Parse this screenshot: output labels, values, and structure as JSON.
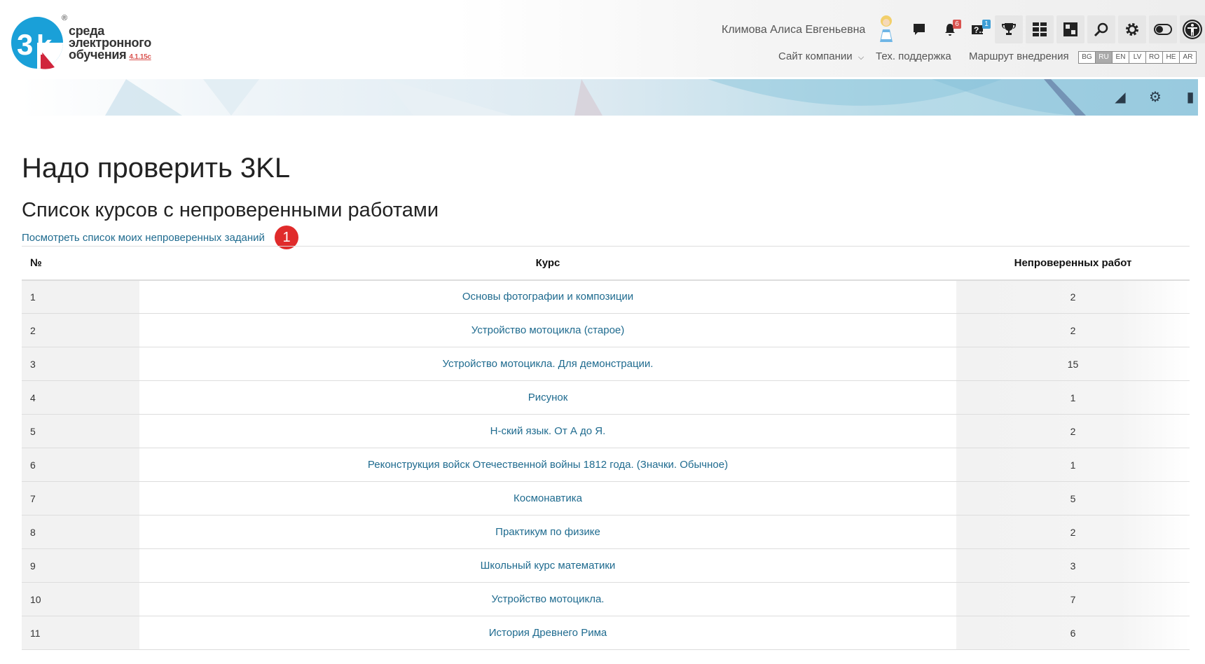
{
  "logo": {
    "line1": "среда",
    "line2": "электронного",
    "line3": "обучения",
    "version": "4.1.15c",
    "registered": "®"
  },
  "header": {
    "user_name": "Климова Алиса Евгеньевна",
    "notifications_count": "6",
    "questions_count": "1",
    "nav": {
      "company_site": "Сайт компании",
      "support": "Тех. поддержка",
      "roadmap": "Маршрут внедрения"
    },
    "languages": [
      "BG",
      "RU",
      "EN",
      "LV",
      "RO",
      "HE",
      "AR"
    ],
    "active_language": "RU"
  },
  "page": {
    "title": "Надо проверить 3KL",
    "subtitle": "Список курсов с непроверенными работами",
    "my_tasks_link": "Посмотреть список моих непроверенных заданий",
    "step_marker": "1"
  },
  "table": {
    "headers": {
      "num": "№",
      "course": "Курс",
      "count": "Непроверенных работ"
    },
    "rows": [
      {
        "num": "1",
        "course": "Основы фотографии и композиции",
        "count": "2"
      },
      {
        "num": "2",
        "course": "Устройство мотоцикла (старое)",
        "count": "2"
      },
      {
        "num": "3",
        "course": "Устройство мотоцикла. Для демонстрации.",
        "count": "15"
      },
      {
        "num": "4",
        "course": "Рисунок",
        "count": "1"
      },
      {
        "num": "5",
        "course": "Н-ский язык. От А до Я.",
        "count": "2"
      },
      {
        "num": "6",
        "course": "Реконструкция войск Отечественной войны 1812 года. (Значки. Обычное)",
        "count": "1"
      },
      {
        "num": "7",
        "course": "Космонавтика",
        "count": "5"
      },
      {
        "num": "8",
        "course": "Практикум по физике",
        "count": "2"
      },
      {
        "num": "9",
        "course": "Школьный курс математики",
        "count": "3"
      },
      {
        "num": "10",
        "course": "Устройство мотоцикла.",
        "count": "7"
      },
      {
        "num": "11",
        "course": "История Древнего Рима",
        "count": "6"
      }
    ]
  },
  "colors": {
    "link": "#1f6b8f",
    "step_marker": "#e02b2b",
    "badge_notifications": "#d9534f",
    "badge_questions": "#3d9ed6",
    "logo_blue": "#1aa0d8",
    "logo_red": "#d0253c"
  }
}
